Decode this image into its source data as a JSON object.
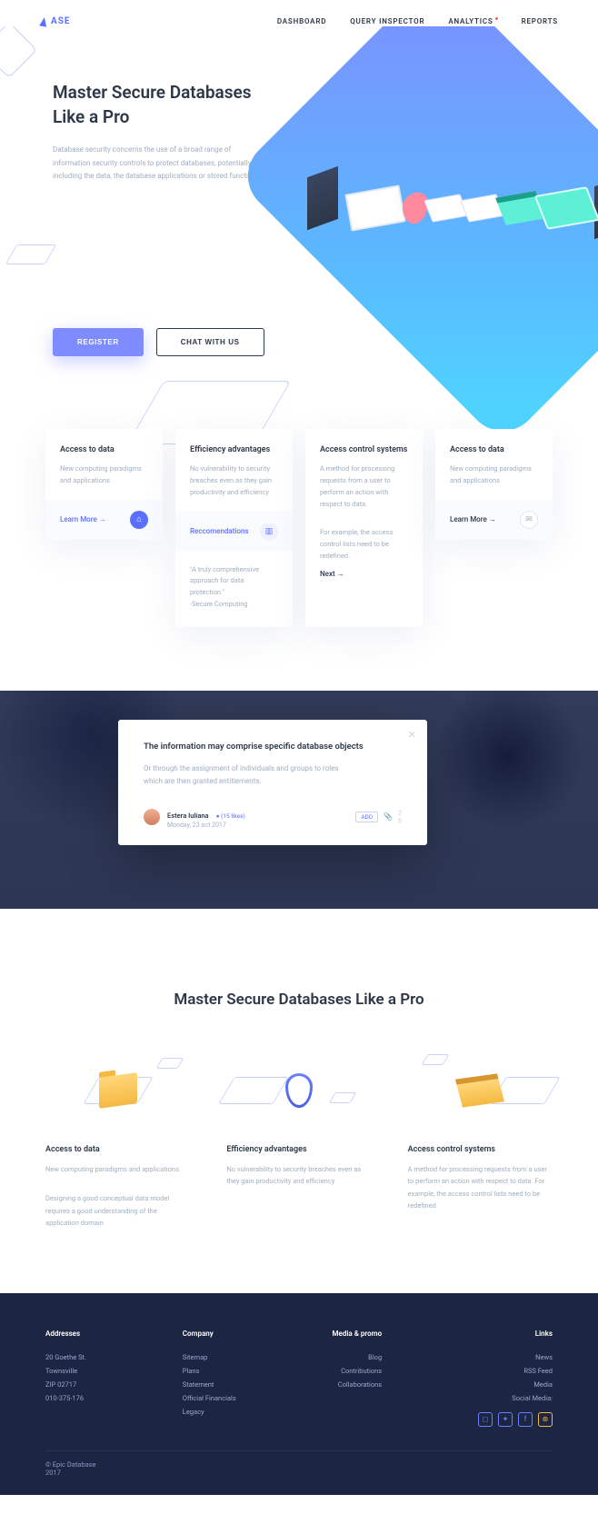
{
  "brand": "ASE",
  "nav": [
    "DASHBOARD",
    "QUERY INSPECTOR",
    "ANALYTICS",
    "REPORTS"
  ],
  "hero": {
    "title_l1": "Master Secure Databases",
    "title_l2": "Like a Pro",
    "desc": "Database security concerns the use of a broad range of information security controls to protect databases, potentially including the data, the database applications or stored functions",
    "cta_primary": "REGISTER",
    "cta_secondary": "CHAT WITH US"
  },
  "cards": [
    {
      "title": "Access to data",
      "body": "New computing paradigms and applications",
      "footer_link": "Learn More →",
      "icon": "monitor"
    },
    {
      "title": "Efficiency advantages",
      "body": "No vulnerability to security breaches even as they gain productivity and efficiency",
      "footer_link": "Reccomendations",
      "quote": "\"A truly comprehensive approach for data protection.\"",
      "quote_src": "-Secure Computing"
    },
    {
      "title": "Access control systems",
      "body": "A method for processing requests from a user to perform an action with respect to data.",
      "body2": "For example, the access control lists need to be redefined.",
      "next": "Next →"
    },
    {
      "title": "Access to data",
      "body": "New computing paradigms and applications",
      "footer_link": "Learn More →",
      "icon": "chat"
    }
  ],
  "testi": {
    "title": "The information may comprise specific database objects",
    "body": "Or through the assignment of individuals and groups to roles which are then granted entitlements.",
    "name": "Estera Iuliana",
    "badge": "(15 likes)",
    "date": "Monday, 23 oct 2017",
    "tag": "ADD",
    "count": "2",
    "count2": "6"
  },
  "features": {
    "title": "Master Secure Databases Like a Pro",
    "items": [
      {
        "title": "Access to data",
        "p1": "New computing paradigms and applications.",
        "p2": "Designing a good conceptual data model requires a good understanding of the application domain"
      },
      {
        "title": "Efficiency advantages",
        "p1": "No vulnerability to security breaches even as they gain productivity and efficiency"
      },
      {
        "title": "Access control systems",
        "p1": "A method for processing requests from a user to perform an action with respect to data. For example, the access control lists need to be redefined"
      }
    ]
  },
  "footer": {
    "cols": [
      {
        "h": "Addresses",
        "items": [
          "20 Goethe St.",
          "Townsville",
          "ZIP 02717",
          "010-375-176"
        ]
      },
      {
        "h": "Company",
        "items": [
          "Sitemap",
          "Plans",
          "Statement",
          "Official Financials",
          "Legacy"
        ]
      },
      {
        "h": "Media & promo",
        "items": [
          "Blog",
          "Contributions",
          "Collaborations"
        ]
      },
      {
        "h": "Links",
        "items": [
          "News",
          "RSS Feed",
          "Media",
          "Social Media:"
        ]
      }
    ],
    "copy1": "© Epic Database",
    "copy2": "2017"
  }
}
